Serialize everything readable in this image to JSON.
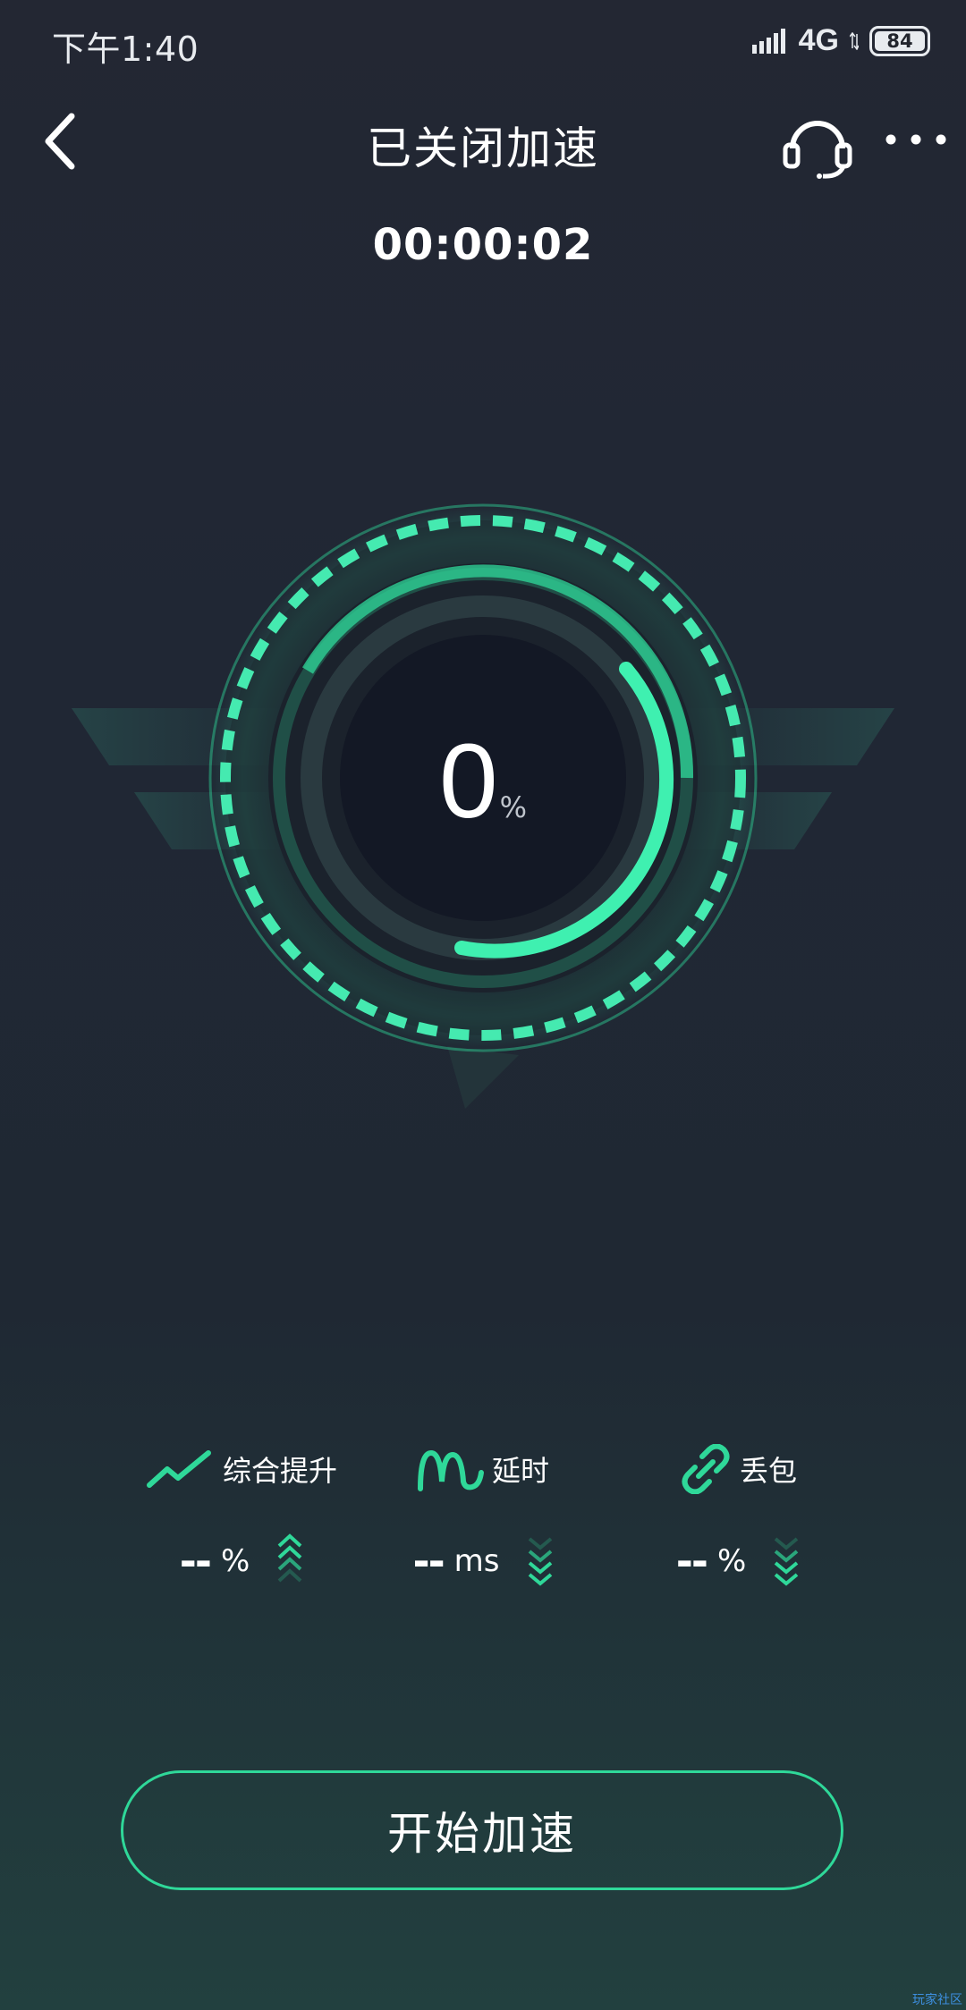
{
  "status_bar": {
    "time": "下午1:40",
    "network": "4G",
    "battery": "84"
  },
  "header": {
    "title": "已关闭加速",
    "timer": "00:00:02",
    "icons": [
      "back-icon",
      "headset-icon",
      "more-icon"
    ]
  },
  "gauge": {
    "value": "0",
    "unit": "%"
  },
  "metrics": [
    {
      "label": "综合提升",
      "value": "--",
      "unit": "%",
      "icon": "trend-up-icon",
      "indicator": "chevrons-up-icon"
    },
    {
      "label": "延时",
      "value": "--",
      "unit": "ms",
      "icon": "wave-icon",
      "indicator": "chevrons-down-icon"
    },
    {
      "label": "丢包",
      "value": "--",
      "unit": "%",
      "icon": "link-icon",
      "indicator": "chevrons-down-icon"
    }
  ],
  "action": {
    "start_label": "开始加速"
  },
  "watermark": "玩家社区",
  "colors": {
    "accent": "#2fd899",
    "accent_light": "#54f0b4",
    "background": "#232733",
    "gauge_center": "#131825"
  }
}
